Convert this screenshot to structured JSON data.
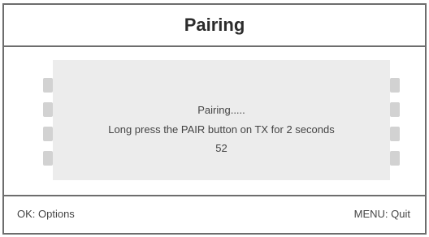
{
  "title": "Pairing",
  "dialog": {
    "status": "Pairing.....",
    "instruction": "Long press the PAIR button on TX for 2 seconds",
    "countdown": "52"
  },
  "footer": {
    "left_hint": "OK: Options",
    "right_hint": "MENU: Quit"
  },
  "colors": {
    "border": "#6d6d6d",
    "panel": "#ececec",
    "tab": "#d2d2d2",
    "text": "#444444"
  }
}
